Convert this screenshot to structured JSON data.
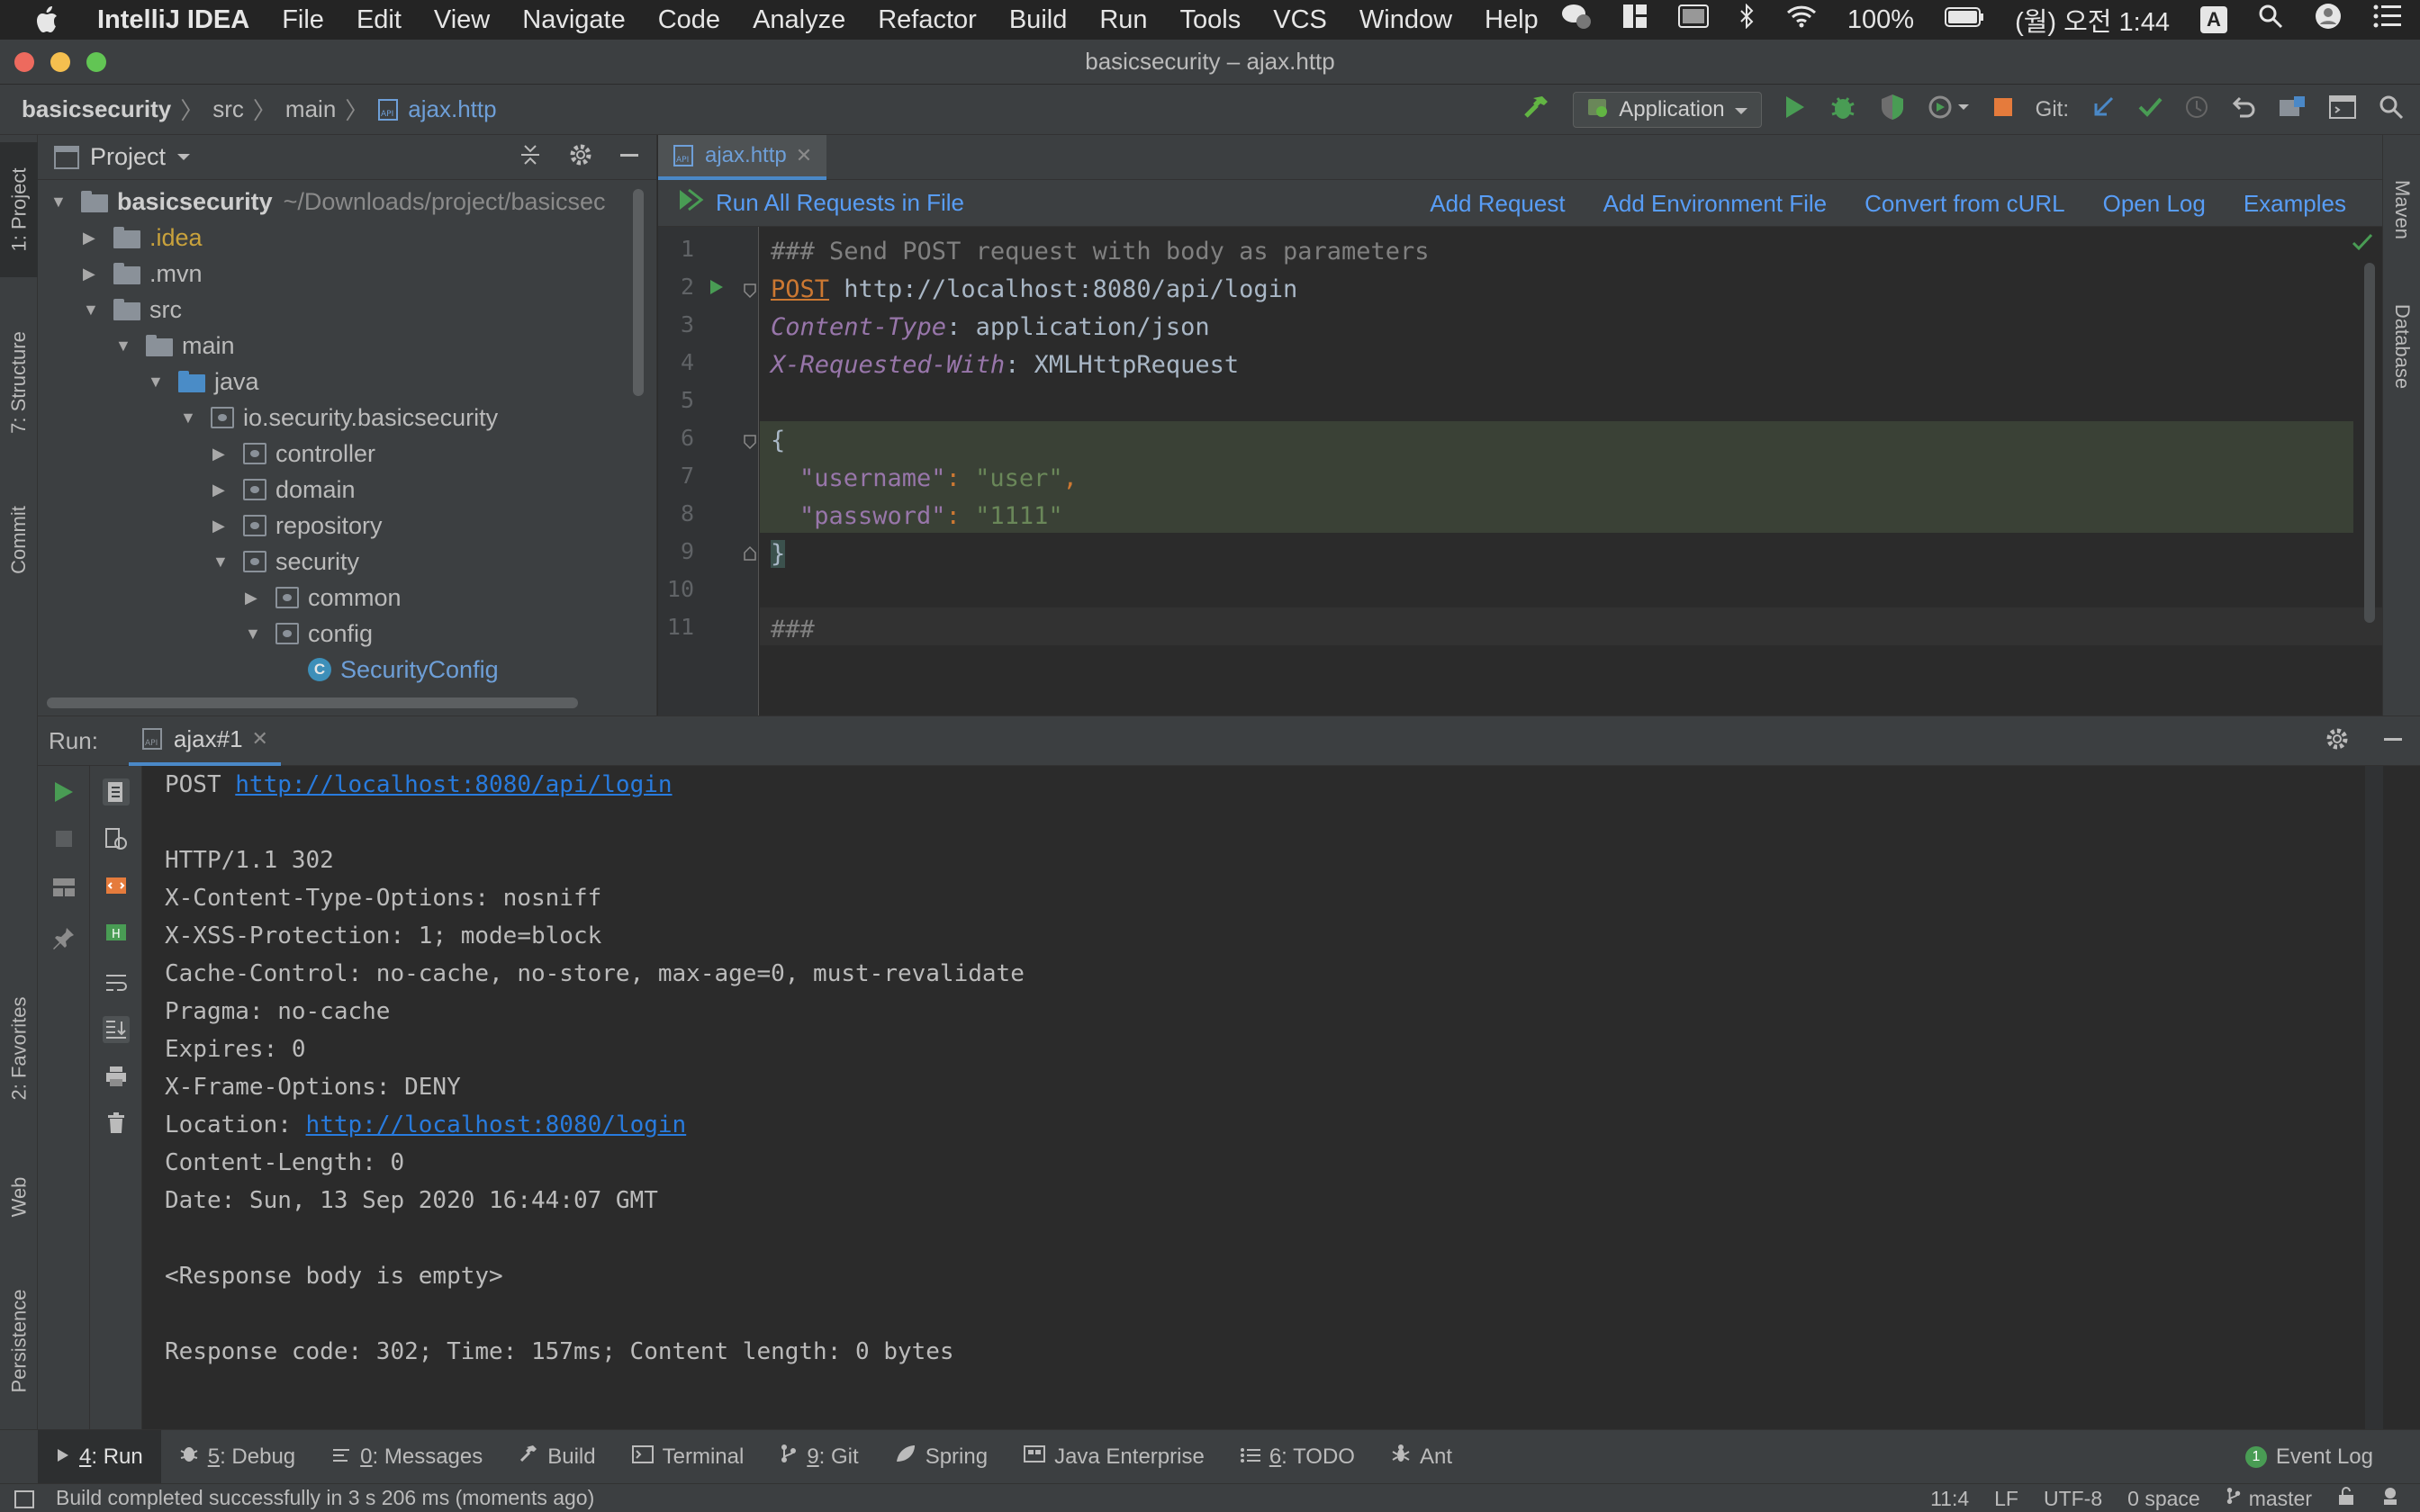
{
  "menubar": {
    "app_name": "IntelliJ IDEA",
    "items": [
      "File",
      "Edit",
      "View",
      "Navigate",
      "Code",
      "Analyze",
      "Refactor",
      "Build",
      "Run",
      "Tools",
      "VCS",
      "Window",
      "Help"
    ],
    "battery": "100%",
    "clock": "(월) 오전 1:44",
    "input_source": "A"
  },
  "window": {
    "title": "basicsecurity – ajax.http"
  },
  "navbar": {
    "crumbs": [
      "basicsecurity",
      "src",
      "main",
      "ajax.http"
    ],
    "run_config": "Application",
    "git_label": "Git:"
  },
  "left_stripe": {
    "tabs": [
      "1: Project",
      "7: Structure",
      "Commit",
      "2: Favorites",
      "Web",
      "Persistence"
    ]
  },
  "right_stripe": {
    "tabs": [
      "Maven",
      "Database"
    ]
  },
  "project": {
    "title": "Project",
    "root_name": "basicsecurity",
    "root_path": "~/Downloads/project/basicsec",
    "items": [
      ".idea",
      ".mvn",
      "src",
      "main",
      "java",
      "io.security.basicsecurity",
      "controller",
      "domain",
      "repository",
      "security",
      "common",
      "config",
      "SecurityConfig"
    ]
  },
  "editor": {
    "tab_label": "ajax.http",
    "run_all": "Run All Requests in File",
    "actions": [
      "Add Request",
      "Add Environment File",
      "Convert from cURL",
      "Open Log",
      "Examples"
    ],
    "line_numbers": [
      "1",
      "2",
      "3",
      "4",
      "5",
      "6",
      "7",
      "8",
      "9",
      "10",
      "11"
    ],
    "code": {
      "l1": "### Send POST request with body as parameters",
      "l2_method": "POST",
      "l2_url": " http://localhost:8080/api/login",
      "l3_name": "Content-Type",
      "l3_value": ": application/json",
      "l4_name": "X-Requested-With",
      "l4_value": ": XMLHttpRequest",
      "l6": "{",
      "l7_key": "\"username\"",
      "l7_colon": ": ",
      "l7_val": "\"user\"",
      "l7_comma": ",",
      "l8_key": "\"password\"",
      "l8_colon": ": ",
      "l8_val": "\"1111\"",
      "l9": "}",
      "l11": "###"
    }
  },
  "run_panel": {
    "label": "Run:",
    "tab": "ajax#1",
    "console": {
      "request_method": "POST ",
      "request_url": "http://localhost:8080/api/login",
      "status": "HTTP/1.1 302",
      "h1": "X-Content-Type-Options: nosniff",
      "h2": "X-XSS-Protection: 1; mode=block",
      "h3": "Cache-Control: no-cache, no-store, max-age=0, must-revalidate",
      "h4": "Pragma: no-cache",
      "h5": "Expires: 0",
      "h6": "X-Frame-Options: DENY",
      "location_label": "Location: ",
      "location_url": "http://localhost:8080/login",
      "h8": "Content-Length: 0",
      "h9": "Date: Sun, 13 Sep 2020 16:44:07 GMT",
      "body": "<Response body is empty>",
      "summary": "Response code: 302; Time: 157ms; Content length: 0 bytes"
    }
  },
  "bottom_tools": {
    "items": [
      {
        "num": "4",
        "label": ": Run"
      },
      {
        "num": "5",
        "label": ": Debug"
      },
      {
        "num": "0",
        "label": ": Messages"
      },
      {
        "num": "",
        "label": "Build"
      },
      {
        "num": "",
        "label": "Terminal"
      },
      {
        "num": "9",
        "label": ": Git"
      },
      {
        "num": "",
        "label": "Spring"
      },
      {
        "num": "",
        "label": "Java Enterprise"
      },
      {
        "num": "6",
        "label": ": TODO"
      },
      {
        "num": "",
        "label": "Ant"
      }
    ],
    "event_log": "Event Log",
    "event_count": "1"
  },
  "statusbar": {
    "message": "Build completed successfully in 3 s 206 ms (moments ago)",
    "position": "11:4",
    "line_sep": "LF",
    "encoding": "UTF-8",
    "indent": "0 space",
    "branch": "master"
  },
  "colors": {
    "accent": "#4a88c7",
    "link": "#589df6",
    "run_green": "#499c54",
    "stop_orange": "#e57b3c"
  }
}
